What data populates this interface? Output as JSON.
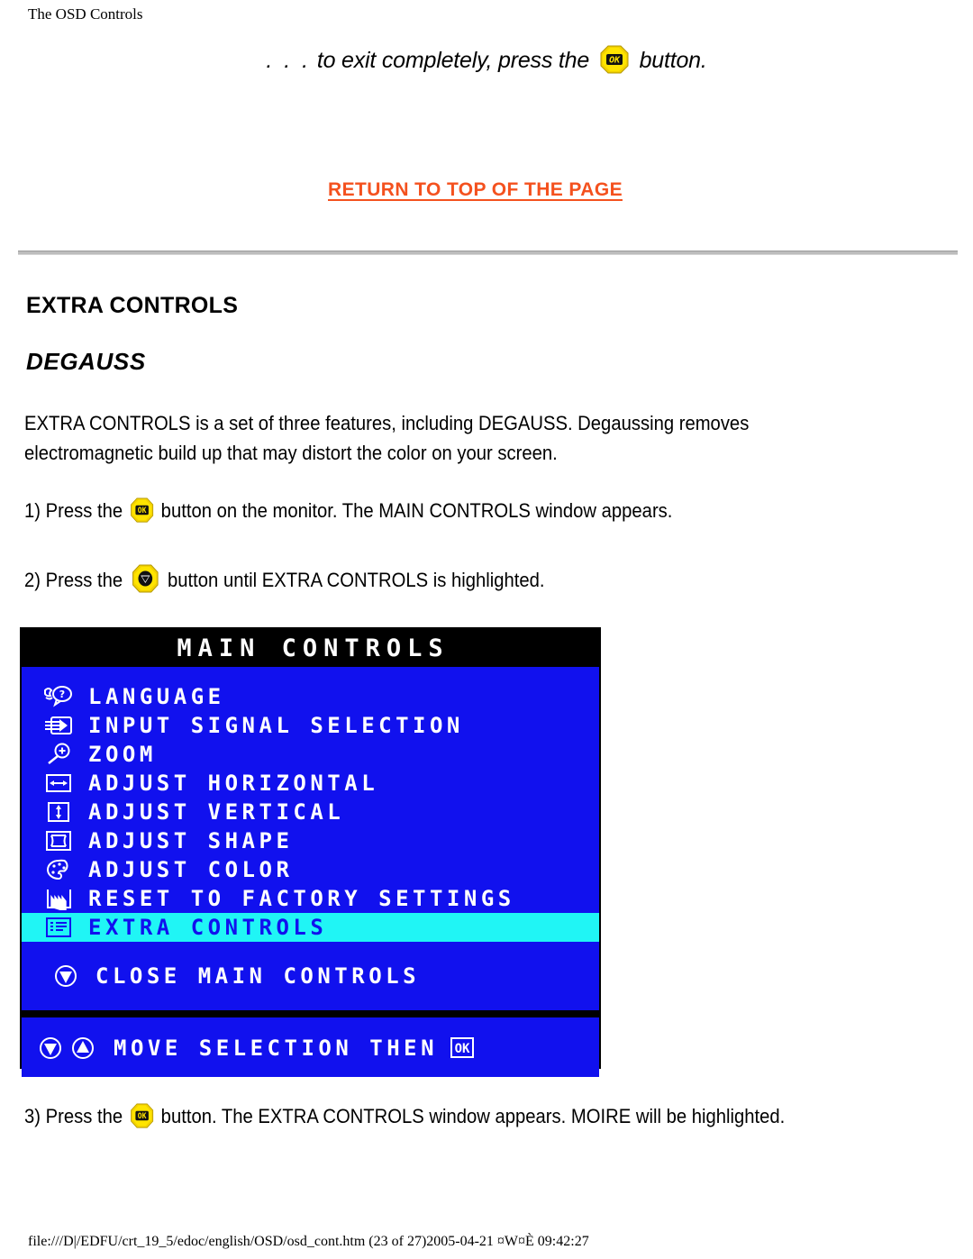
{
  "header": {
    "running_title": "The OSD Controls"
  },
  "intro": {
    "dots": ". . .",
    "text_before": " to exit completely, press the",
    "button_icon": "ok-button-icon",
    "text_after": "button."
  },
  "return_link": {
    "label": "RETURN TO TOP OF THE PAGE",
    "color": "#F4511E"
  },
  "headings": {
    "section": "EXTRA CONTROLS",
    "subsection": "DEGAUSS"
  },
  "paragraph": {
    "text": "EXTRA CONTROLS is a set of three features, including DEGAUSS. Degaussing removes electromagnetic build up that may distort the color on your screen."
  },
  "steps": [
    {
      "number": "1)",
      "text_before": "Press the",
      "icon": "ok-button-icon",
      "text_after": "button on the monitor. The MAIN CONTROLS window appears."
    },
    {
      "number": "2)",
      "text_before": "Press the",
      "icon": "down-button-icon",
      "text_after": "button until EXTRA CONTROLS is highlighted."
    },
    {
      "number": "3)",
      "text_before": "Press the",
      "icon": "ok-button-icon",
      "text_after": "button. The EXTRA CONTROLS window appears. MOIRE will be highlighted."
    }
  ],
  "osd": {
    "title": "MAIN CONTROLS",
    "colors": {
      "background": "#1111EE",
      "title_bar": "#000000",
      "text": "#FFFFFF",
      "highlight": "#20F5F5",
      "highlight_text": "#1111EE"
    },
    "items": [
      {
        "icon": "language-face-question-icon",
        "label": "LANGUAGE",
        "selected": false
      },
      {
        "icon": "input-signal-arrow-icon",
        "label": "INPUT SIGNAL SELECTION",
        "selected": false
      },
      {
        "icon": "zoom-magnifier-plus-icon",
        "label": "ZOOM",
        "selected": false
      },
      {
        "icon": "adjust-horizontal-icon",
        "label": "ADJUST HORIZONTAL",
        "selected": false
      },
      {
        "icon": "adjust-vertical-icon",
        "label": "ADJUST VERTICAL",
        "selected": false
      },
      {
        "icon": "adjust-shape-icon",
        "label": "ADJUST SHAPE",
        "selected": false
      },
      {
        "icon": "adjust-color-palette-icon",
        "label": "ADJUST COLOR",
        "selected": false
      },
      {
        "icon": "reset-factory-icon",
        "label": "RESET TO FACTORY SETTINGS",
        "selected": false
      },
      {
        "icon": "extra-controls-list-icon",
        "label": "EXTRA CONTROLS",
        "selected": true
      }
    ],
    "close_item": {
      "icon": "down-arrow-circle-icon",
      "label": "CLOSE MAIN CONTROLS"
    },
    "footer": {
      "icons": "down-up-arrow-circle-icons",
      "label": "MOVE SELECTION THEN",
      "ok_glyph": "OK"
    }
  },
  "file_path": "file:///D|/EDFU/crt_19_5/edoc/english/OSD/osd_cont.htm (23 of 27)2005-04-21 ¤W¤È 09:42:27"
}
